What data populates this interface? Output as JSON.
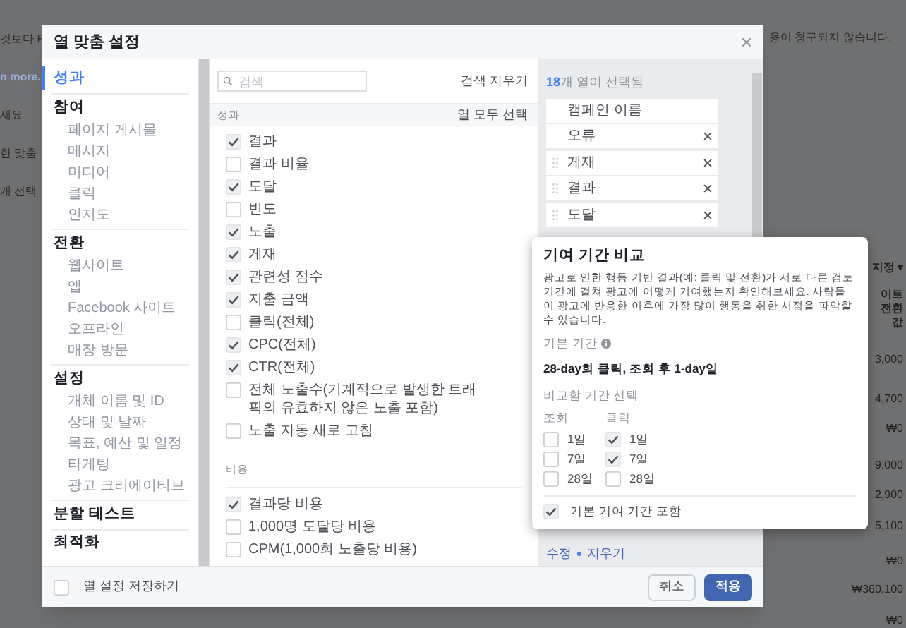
{
  "background": {
    "left_texts": [
      "것보다 F",
      "n more.",
      "세요",
      "한 맞춤",
      "개 선택"
    ],
    "notice": "용이 청구되지 않습니다.",
    "column_menu": "지정 ▾",
    "column_header": "이트 전환 값",
    "values": [
      "3,000",
      "4,700",
      "₩0",
      "9,000",
      "2,900",
      "5,100",
      "₩0",
      "₩360,100",
      "₩0"
    ]
  },
  "dialog": {
    "title": "열 맞춤 설정",
    "nav": [
      {
        "label": "성과",
        "selected": true
      },
      {
        "label": "참여",
        "selected": false,
        "children": [
          "페이지 게시물",
          "메시지",
          "미디어",
          "클릭",
          "인지도"
        ]
      },
      {
        "label": "전환",
        "selected": false,
        "children": [
          "웹사이트",
          "앱",
          "Facebook 사이트",
          "오프라인",
          "매장 방문"
        ]
      },
      {
        "label": "설정",
        "selected": false,
        "children": [
          "개체 이름 및 ID",
          "상태 및 날짜",
          "목표, 예산 및 일정",
          "타게팅",
          "광고 크리에이티브"
        ]
      },
      {
        "label": "분할 테스트",
        "selected": false
      },
      {
        "label": "최적화",
        "selected": false
      }
    ],
    "search": {
      "placeholder": "검색"
    },
    "clear_search": "검색 지우기",
    "sections": [
      {
        "title": "성과",
        "select_all": "열 모두 선택",
        "items": [
          {
            "label": "결과",
            "checked": true
          },
          {
            "label": "결과 비율",
            "checked": false
          },
          {
            "label": "도달",
            "checked": true
          },
          {
            "label": "빈도",
            "checked": false
          },
          {
            "label": "노출",
            "checked": true
          },
          {
            "label": "게재",
            "checked": true
          },
          {
            "label": "관련성 점수",
            "checked": true
          },
          {
            "label": "지출 금액",
            "checked": true
          },
          {
            "label": "클릭(전체)",
            "checked": false
          },
          {
            "label": "CPC(전체)",
            "checked": true
          },
          {
            "label": "CTR(전체)",
            "checked": true
          },
          {
            "label": "전체 노출수(기계적으로 발생한 트래픽의 유효하지 않은 노출 포함)",
            "checked": false
          },
          {
            "label": "노출 자동 새로 고침",
            "checked": false
          }
        ]
      },
      {
        "title": "비용",
        "items": [
          {
            "label": "결과당 비용",
            "checked": true
          },
          {
            "label": "1,000명 도달당 비용",
            "checked": false
          },
          {
            "label": "CPM(1,000회 노출당 비용)",
            "checked": false
          }
        ]
      }
    ],
    "selected_count": "18",
    "selected_label": "개 열이 선택됨",
    "selected_columns": [
      {
        "label": "캠페인 이름",
        "draggable": false,
        "removable": false
      },
      {
        "label": "오류",
        "draggable": false,
        "removable": true
      },
      {
        "label": "게재",
        "draggable": true,
        "removable": true
      },
      {
        "label": "결과",
        "draggable": true,
        "removable": true
      },
      {
        "label": "도달",
        "draggable": true,
        "removable": true
      }
    ],
    "links": [
      "수정",
      "지우기"
    ],
    "save_settings": {
      "label": "열 설정 저장하기",
      "checked": false
    },
    "buttons": [
      {
        "label": "취소",
        "kind": "secondary"
      },
      {
        "label": "적용",
        "kind": "primary"
      }
    ]
  },
  "popover": {
    "title": "기여 기간 비교",
    "description": "광고로 인한 행동 기반 결과(예: 클릭 및 전환)가 서로 다른 검토 기간에 걸쳐 광고에 어떻게 기여했는지 확인해보세요. 사람들이 광고에 반응한 이후에 가장 많이 행동을 취한 시점을 파악할 수 있습니다.",
    "default_label": "기본 기간",
    "default_value": "28-day회 클릭, 조회 후 1-day일",
    "compare_label": "비교할 기간 선택",
    "groups": [
      {
        "title": "조회",
        "options": [
          {
            "label": "1일",
            "checked": false
          },
          {
            "label": "7일",
            "checked": false
          },
          {
            "label": "28일",
            "checked": false
          }
        ]
      },
      {
        "title": "클릭",
        "options": [
          {
            "label": "1일",
            "checked": true
          },
          {
            "label": "7일",
            "checked": true
          },
          {
            "label": "28일",
            "checked": false
          }
        ]
      }
    ],
    "include_default": {
      "label": "기본 기여 기간 포함",
      "checked": true
    }
  }
}
